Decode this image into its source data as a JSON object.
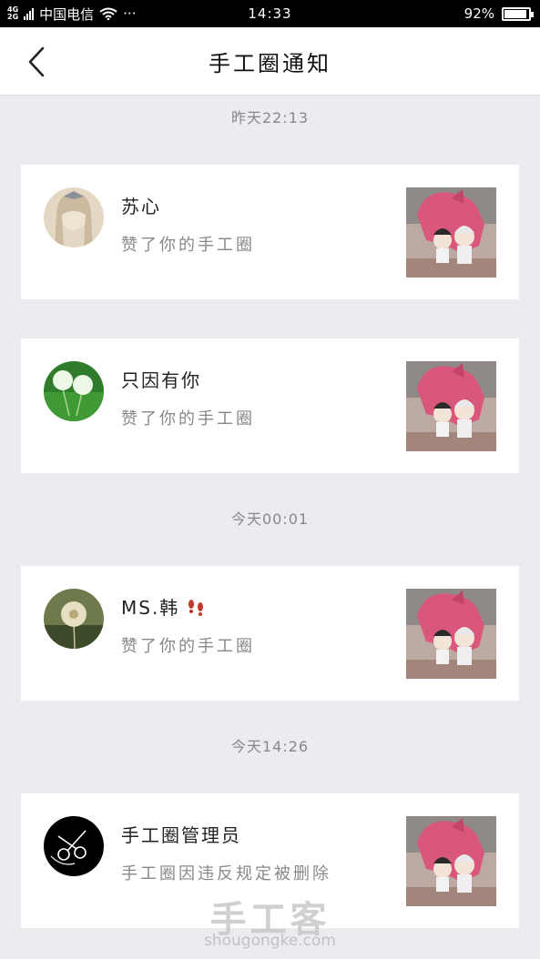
{
  "status_bar": {
    "network_top": "4G",
    "network_bottom": "2G",
    "carrier": "中国电信",
    "dots": "···",
    "time": "14:33",
    "battery_text": "92%",
    "battery_level": 0.92
  },
  "header": {
    "title": "手工圈通知"
  },
  "groups": [
    {
      "time": "昨天22:13",
      "items": [
        {
          "name": "苏心",
          "message": "赞了你的手工圈"
        },
        {
          "name": "只因有你",
          "message": "赞了你的手工圈"
        }
      ]
    },
    {
      "time": "今天00:01",
      "items": [
        {
          "name": "MS.韩",
          "message": "赞了你的手工圈"
        }
      ]
    },
    {
      "time": "今天14:26",
      "items": [
        {
          "name": "手工圈管理员",
          "message": "手工圈因违反规定被删除"
        }
      ]
    }
  ],
  "watermark": {
    "brand": "手工客",
    "domain": "shougongke.com"
  },
  "colors": {
    "background": "#ebebf0",
    "card": "#ffffff",
    "muted_text": "#888888",
    "thumb_pink": "#d9577a"
  }
}
